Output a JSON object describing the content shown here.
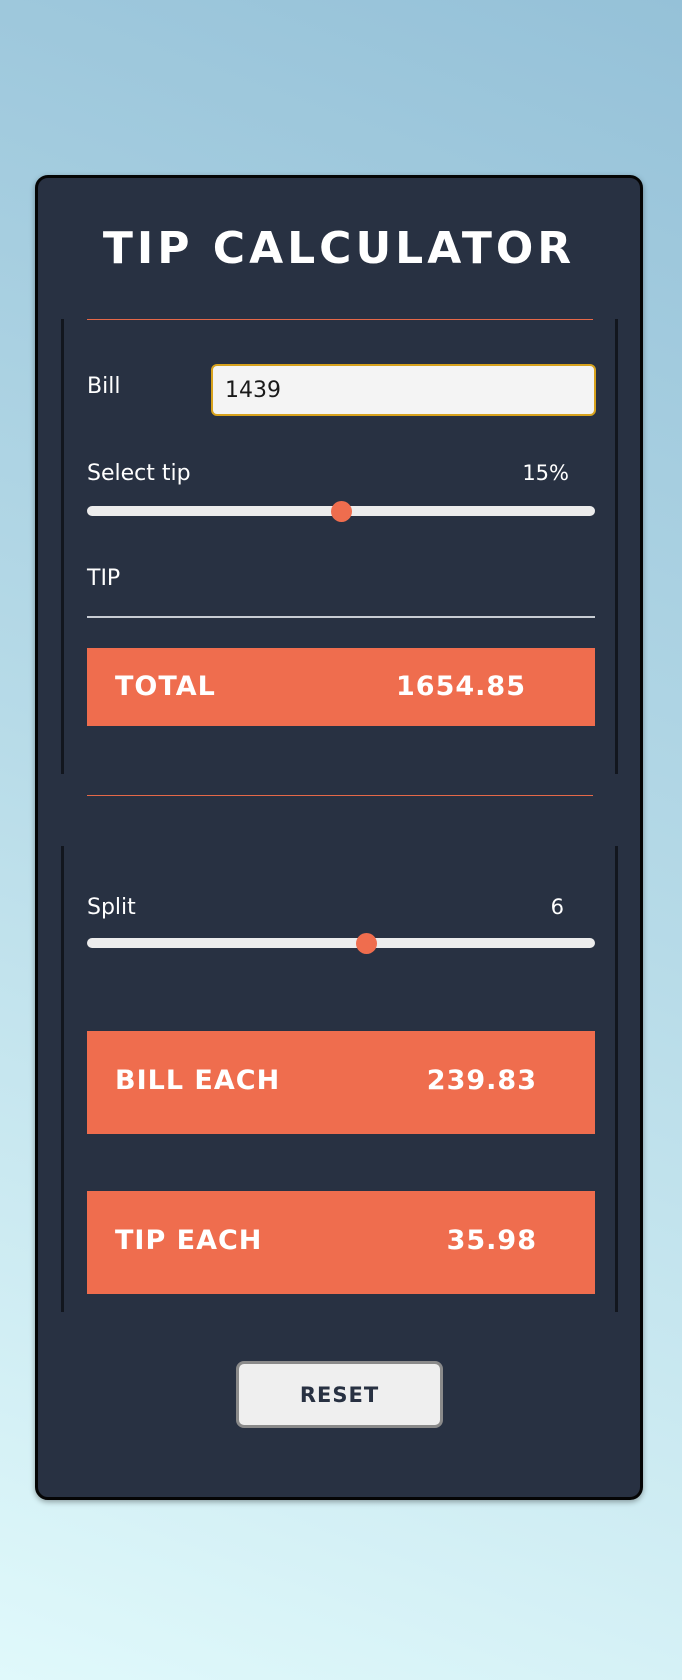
{
  "app": {
    "title": "TIP CALCULATOR"
  },
  "tip_section": {
    "bill_label": "Bill",
    "bill_value": "1439",
    "select_tip_label": "Select tip",
    "tip_percent_display": "15%",
    "tip_slider_fraction": 0.5,
    "tip_label": "TIP",
    "tip_value": "",
    "total_label": "TOTAL",
    "total_value": "1654.85"
  },
  "split_section": {
    "split_label": "Split",
    "split_value": "6",
    "split_slider_fraction": 0.55,
    "bill_each_label": "BILL EACH",
    "bill_each_value": "239.83",
    "tip_each_label": "TIP EACH",
    "tip_each_value": "35.98"
  },
  "actions": {
    "reset_label": "RESET"
  },
  "colors": {
    "card_background": "#283142",
    "accent": "#ef6d4e",
    "input_border": "#d7a21d"
  }
}
